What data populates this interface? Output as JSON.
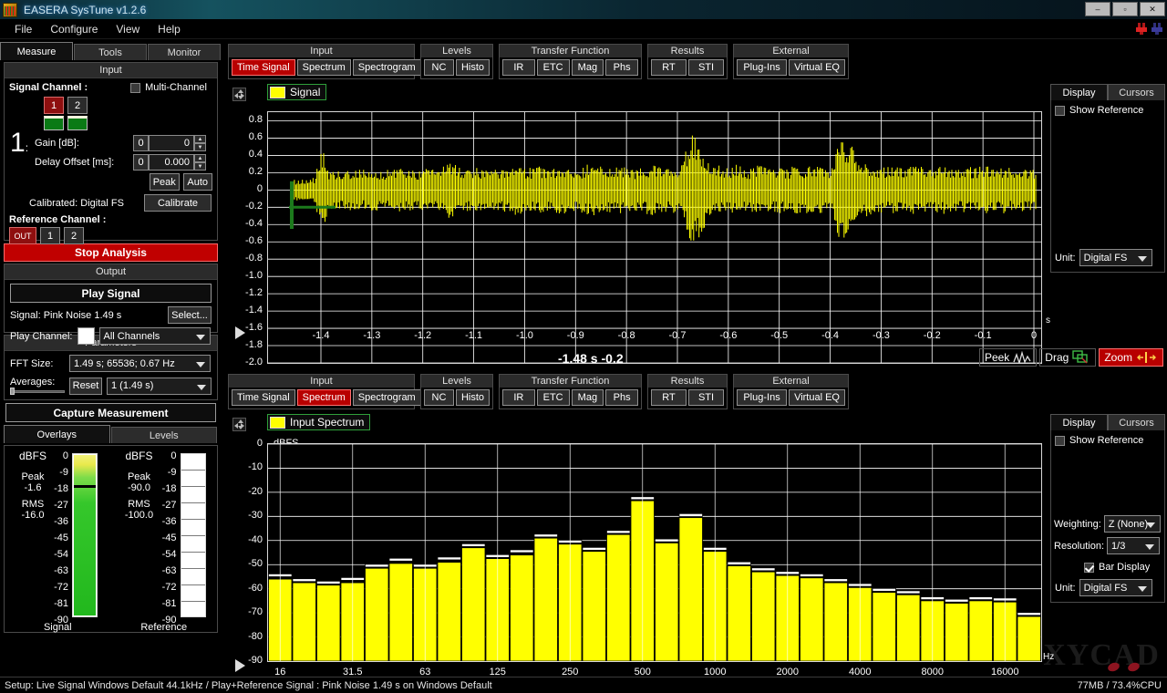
{
  "window": {
    "title": "EASERA SysTune v1.2.6",
    "icon": "app-icon",
    "buttons": {
      "minimize": "–",
      "maximize": "▫",
      "close": "✕"
    }
  },
  "menu": {
    "items": [
      "File",
      "Configure",
      "View",
      "Help"
    ]
  },
  "left_panel": {
    "tabs": [
      {
        "label": "Measure",
        "active": true
      },
      {
        "label": "Tools",
        "active": false
      },
      {
        "label": "Monitor",
        "active": false
      }
    ],
    "input_group": {
      "title": "Input",
      "signal_channel_label": "Signal Channel :",
      "multi_channel_label": "Multi-Channel",
      "multi_channel_checked": false,
      "channel_buttons": [
        {
          "label": "1",
          "active": true
        },
        {
          "label": "2",
          "active": false
        }
      ],
      "channel_index": "1",
      "gain_label": "Gain [dB]:",
      "gain_prefix": "0",
      "gain_value": "0",
      "delay_label": "Delay Offset [ms]:",
      "delay_prefix": "0",
      "delay_value": "0.000",
      "peak_button": "Peak",
      "auto_button": "Auto",
      "calibrated_label": "Calibrated: Digital FS",
      "calibrate_button": "Calibrate",
      "reference_channel_label": "Reference Channel :",
      "reference_buttons": [
        {
          "label": "OUT",
          "active": true
        },
        {
          "label": "1",
          "active": false
        },
        {
          "label": "2",
          "active": false
        }
      ]
    },
    "stop_analysis_button": "Stop Analysis",
    "output_group": {
      "title": "Output",
      "play_signal_button": "Play Signal",
      "signal_label": "Signal: Pink Noise  1.49 s",
      "select_button": "Select...",
      "play_channel_label": "Play Channel:",
      "play_channel_value": "All Channels"
    },
    "parameters_group": {
      "title": "Parameters",
      "fft_size_label": "FFT Size:",
      "fft_size_value": "1.49 s; 65536; 0.67 Hz",
      "averages_label": "Averages:",
      "reset_button": "Reset",
      "averages_value": "1 (1.49 s)"
    },
    "capture_button": "Capture Measurement",
    "meter_tabs": [
      {
        "label": "Overlays",
        "active": true
      },
      {
        "label": "Levels",
        "active": false
      }
    ],
    "meters": [
      {
        "unit": "dBFS",
        "peak_label": "Peak",
        "peak_value": "-1.6",
        "rms_label": "RMS",
        "rms_value": "-16.0",
        "caption": "Signal",
        "scale": [
          "0",
          "-9",
          "-18",
          "-27",
          "-36",
          "-45",
          "-54",
          "-63",
          "-72",
          "-81",
          "-90"
        ],
        "level_db": -1.6,
        "peak_hold_db": -18,
        "filled": true
      },
      {
        "unit": "dBFS",
        "peak_label": "Peak",
        "peak_value": "-90.0",
        "rms_label": "RMS",
        "rms_value": "-100.0",
        "caption": "Reference",
        "scale": [
          "0",
          "-9",
          "-18",
          "-27",
          "-36",
          "-45",
          "-54",
          "-63",
          "-72",
          "-81",
          "-90"
        ],
        "level_db": -90,
        "peak_hold_db": null,
        "filled": false
      }
    ]
  },
  "view_toolbar_groups": [
    {
      "title": "Input",
      "buttons": [
        "Time Signal",
        "Spectrum",
        "Spectrogram"
      ]
    },
    {
      "title": "Levels",
      "buttons": [
        "NC",
        "Histo"
      ]
    },
    {
      "title": "Transfer Function",
      "buttons": [
        "IR",
        "ETC",
        "Mag",
        "Phs"
      ]
    },
    {
      "title": "Results",
      "buttons": [
        "RT",
        "STI"
      ]
    },
    {
      "title": "External",
      "buttons": [
        "Plug-Ins",
        "Virtual EQ"
      ]
    }
  ],
  "top_pane": {
    "active_button": "Time Signal",
    "legend_label": "Signal",
    "legend_color": "#ffff00",
    "readout": "-1.48 s   -0.2",
    "mode_buttons": [
      {
        "label": "Peek",
        "icon": "waveform-icon",
        "active": false
      },
      {
        "label": "Drag",
        "icon": "drag-icon",
        "active": false
      },
      {
        "label": "Zoom",
        "icon": "zoom-arrows-icon",
        "active": true
      }
    ],
    "display_panel": {
      "tabs": [
        {
          "label": "Display",
          "active": true
        },
        {
          "label": "Cursors",
          "active": false
        }
      ],
      "show_reference_label": "Show Reference",
      "show_reference_checked": false,
      "unit_label": "Unit:",
      "unit_value": "Digital FS"
    }
  },
  "bottom_pane": {
    "active_button": "Spectrum",
    "legend_label": "Input Spectrum",
    "legend_color": "#ffff00",
    "display_panel": {
      "tabs": [
        {
          "label": "Display",
          "active": true
        },
        {
          "label": "Cursors",
          "active": false
        }
      ],
      "show_reference_label": "Show Reference",
      "show_reference_checked": false,
      "weighting_label": "Weighting:",
      "weighting_value": "Z (None)",
      "resolution_label": "Resolution:",
      "resolution_value": "1/3",
      "bar_display_label": "Bar Display",
      "bar_display_checked": true,
      "unit_label": "Unit:",
      "unit_value": "Digital FS"
    }
  },
  "status_bar": {
    "text": "Setup: Live Signal Windows Default 44.1kHz / Play+Reference Signal : Pink Noise  1.49 s on Windows Default",
    "cpu": "77MB / 73.4%CPU"
  },
  "watermark": "XYCAD",
  "chart_data": [
    {
      "type": "line",
      "title": "Signal",
      "xlabel": "s",
      "ylabel": "",
      "xlim": [
        -1.49,
        0
      ],
      "ylim": [
        -2.0,
        0.9
      ],
      "xticks": [
        "-1.4",
        "-1.3",
        "-1.2",
        "-1.1",
        "-1.0",
        "-0.9",
        "-0.8",
        "-0.7",
        "-0.6",
        "-0.5",
        "-0.4",
        "-0.3",
        "-0.2",
        "-0.1",
        "0"
      ],
      "yticks": [
        "0.8",
        "0.6",
        "0.4",
        "0.2",
        "0",
        "-0.2",
        "-0.4",
        "-0.6",
        "-0.8",
        "-1.0",
        "-1.2",
        "-1.4",
        "-1.6",
        "-1.8",
        "-2.0"
      ],
      "grid": true,
      "trace_color": "#ffff00",
      "cursor_color": "#1c7a1c",
      "cursor_x": -1.48,
      "cursor_y": -0.2,
      "envelope": [
        0.1,
        0.12,
        0.11,
        0.13,
        0.45,
        0.2,
        0.22,
        0.21,
        0.23,
        0.22,
        0.21,
        0.23,
        0.2,
        0.22,
        0.24,
        0.21,
        0.22,
        0.2,
        0.23,
        0.21,
        0.24,
        0.3,
        0.26,
        0.23,
        0.22,
        0.24,
        0.21,
        0.23,
        0.22,
        0.25,
        0.28,
        0.24,
        0.23,
        0.26,
        0.22,
        0.24,
        0.27,
        0.23,
        0.22,
        0.25,
        0.3,
        0.26,
        0.24,
        0.23,
        0.26,
        0.24,
        0.22,
        0.25,
        0.27,
        0.24,
        0.23,
        0.26,
        0.28,
        0.62,
        0.58,
        0.4,
        0.3,
        0.26,
        0.24,
        0.27,
        0.25,
        0.23,
        0.26,
        0.24,
        0.22,
        0.25,
        0.23,
        0.26,
        0.24,
        0.27,
        0.25,
        0.23,
        0.26,
        0.6,
        0.55,
        0.42,
        0.3,
        0.27,
        0.25,
        0.24,
        0.26,
        0.23,
        0.25,
        0.27,
        0.24,
        0.23,
        0.25,
        0.26,
        0.24,
        0.22,
        0.25,
        0.23,
        0.26,
        0.24,
        0.23,
        0.25,
        0.22,
        0.24,
        0.23,
        0.21
      ]
    },
    {
      "type": "bar",
      "title": "Input Spectrum",
      "xlabel": "Hz",
      "ylabel": "dBFS",
      "ylim": [
        -90,
        0
      ],
      "yticks": [
        "0",
        "-10",
        "-20",
        "-30",
        "-40",
        "-50",
        "-60",
        "-70",
        "-80",
        "-90"
      ],
      "xticks": [
        "16",
        "31.5",
        "63",
        "125",
        "250",
        "500",
        "1000",
        "2000",
        "4000",
        "8000",
        "16000"
      ],
      "grid": true,
      "bar_color": "#ffff00",
      "bar_border": "#000000",
      "peak_cap_color": "#ffffff",
      "categories": [
        "16",
        "20",
        "25",
        "31.5",
        "40",
        "50",
        "63",
        "80",
        "100",
        "125",
        "160",
        "200",
        "250",
        "315",
        "400",
        "500",
        "630",
        "800",
        "1000",
        "1250",
        "1600",
        "2000",
        "2500",
        "3150",
        "4000",
        "5000",
        "6300",
        "8000",
        "10000",
        "12500",
        "16000",
        "20000"
      ],
      "values": [
        -56.0,
        -57.5,
        -58.5,
        -57.5,
        -51.5,
        -49.5,
        -51.5,
        -49.0,
        -43.0,
        -47.5,
        -46.0,
        -39.0,
        -41.5,
        -44.5,
        -37.5,
        -23.5,
        -41.0,
        -30.5,
        -44.5,
        -50.5,
        -53.0,
        -54.5,
        -55.5,
        -57.5,
        -59.5,
        -61.5,
        -62.5,
        -65.0,
        -66.0,
        -65.0,
        -65.5,
        -71.5
      ],
      "peaks": [
        -55.0,
        -57.0,
        -58.0,
        -56.5,
        -51.0,
        -48.5,
        -51.0,
        -48.0,
        -42.5,
        -47.0,
        -45.0,
        -38.5,
        -41.0,
        -44.0,
        -37.0,
        -23.0,
        -40.5,
        -30.0,
        -44.0,
        -50.0,
        -52.5,
        -54.0,
        -55.0,
        -57.0,
        -59.0,
        -61.0,
        -62.0,
        -64.5,
        -65.5,
        -64.5,
        -65.0,
        -71.0
      ]
    }
  ]
}
